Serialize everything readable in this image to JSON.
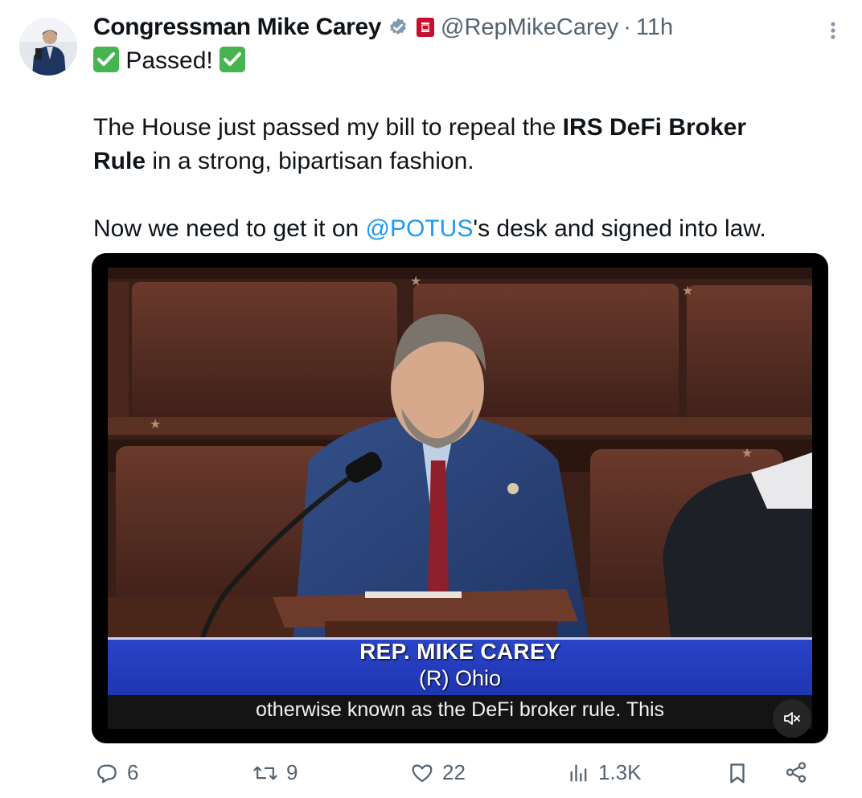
{
  "author": {
    "name": "Congressman Mike Carey",
    "handle": "@RepMikeCarey",
    "separator": "·",
    "time": "11h"
  },
  "icons": {
    "verified": "verified-badge-icon",
    "affiliation": "house-seal-icon",
    "more": "more-vertical-icon",
    "check": "check-mark-icon",
    "mute": "volume-muted-icon"
  },
  "tweet": {
    "line1_text": "Passed!",
    "line2_text": "The House just passed my bill to repeal the ",
    "line2_bold": "IRS DeFi Broker",
    "line3_bold": "Rule",
    "line3_text": " in a strong, bipartisan fashion.",
    "line4_text_a": "Now we need to get it on ",
    "line4_mention": "@POTUS",
    "line4_text_b": "'s desk and signed into law."
  },
  "video": {
    "chyron_name": "REP. MIKE CAREY",
    "chyron_party": "(R) Ohio",
    "caption": "otherwise known as the DeFi broker rule. This"
  },
  "actions": {
    "replies": "6",
    "reposts": "9",
    "likes": "22",
    "views": "1.3K"
  },
  "colors": {
    "accent": "#1d9bf0",
    "muted": "#536471",
    "check": "#46b450",
    "chyron": "#1f35b0"
  }
}
